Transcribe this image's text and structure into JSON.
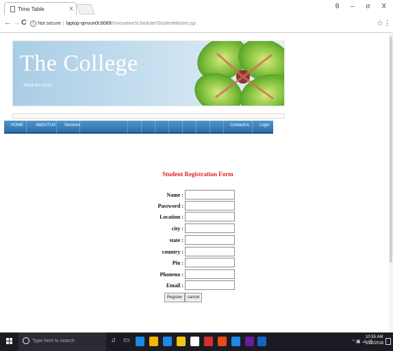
{
  "browser": {
    "tab_title": "Time Table",
    "tab_close": "x",
    "window_controls": [
      "θ",
      "–",
      "σ",
      "X"
    ],
    "nav_back": "←",
    "nav_forward": "→",
    "reload": "C",
    "security_label": "Not secure",
    "url_host": "laptop-qmvun0t:8089",
    "url_path": "/InnovativeScheduler/StudentMaster.jsp",
    "bookmark_star": "☆",
    "menu": "⋮"
  },
  "site": {
    "banner_title": "The College",
    "banner_subtitle": "About the ACCI",
    "nav_items": [
      "HOME",
      "ABOUTUS",
      "Services",
      "ContactUs",
      "Login"
    ]
  },
  "form": {
    "title": "Student Registration Form",
    "fields": [
      {
        "label": "Name :",
        "value": ""
      },
      {
        "label": "Password :",
        "value": ""
      },
      {
        "label": "Location :",
        "value": ""
      },
      {
        "label": "city :",
        "value": ""
      },
      {
        "label": "state :",
        "value": ""
      },
      {
        "label": "country :",
        "value": ""
      },
      {
        "label": "Pin :",
        "value": ""
      },
      {
        "label": "Phoneno :",
        "value": ""
      },
      {
        "label": "Email :",
        "value": ""
      }
    ],
    "register_label": "Register",
    "cancel_label": "cancel"
  },
  "taskbar": {
    "search_placeholder": "Type here to search",
    "tray": "^ ▣ ⊿ ◁)",
    "time": "10:55 AM",
    "date": "3/22/2018",
    "app_colors": [
      "#1e88e5",
      "#f5b700",
      "#1e88e5",
      "#f0c419",
      "#ffffff",
      "#d32f2f",
      "#e64a19",
      "#1e88e5",
      "#6a1b9a",
      "#1565c0"
    ]
  }
}
